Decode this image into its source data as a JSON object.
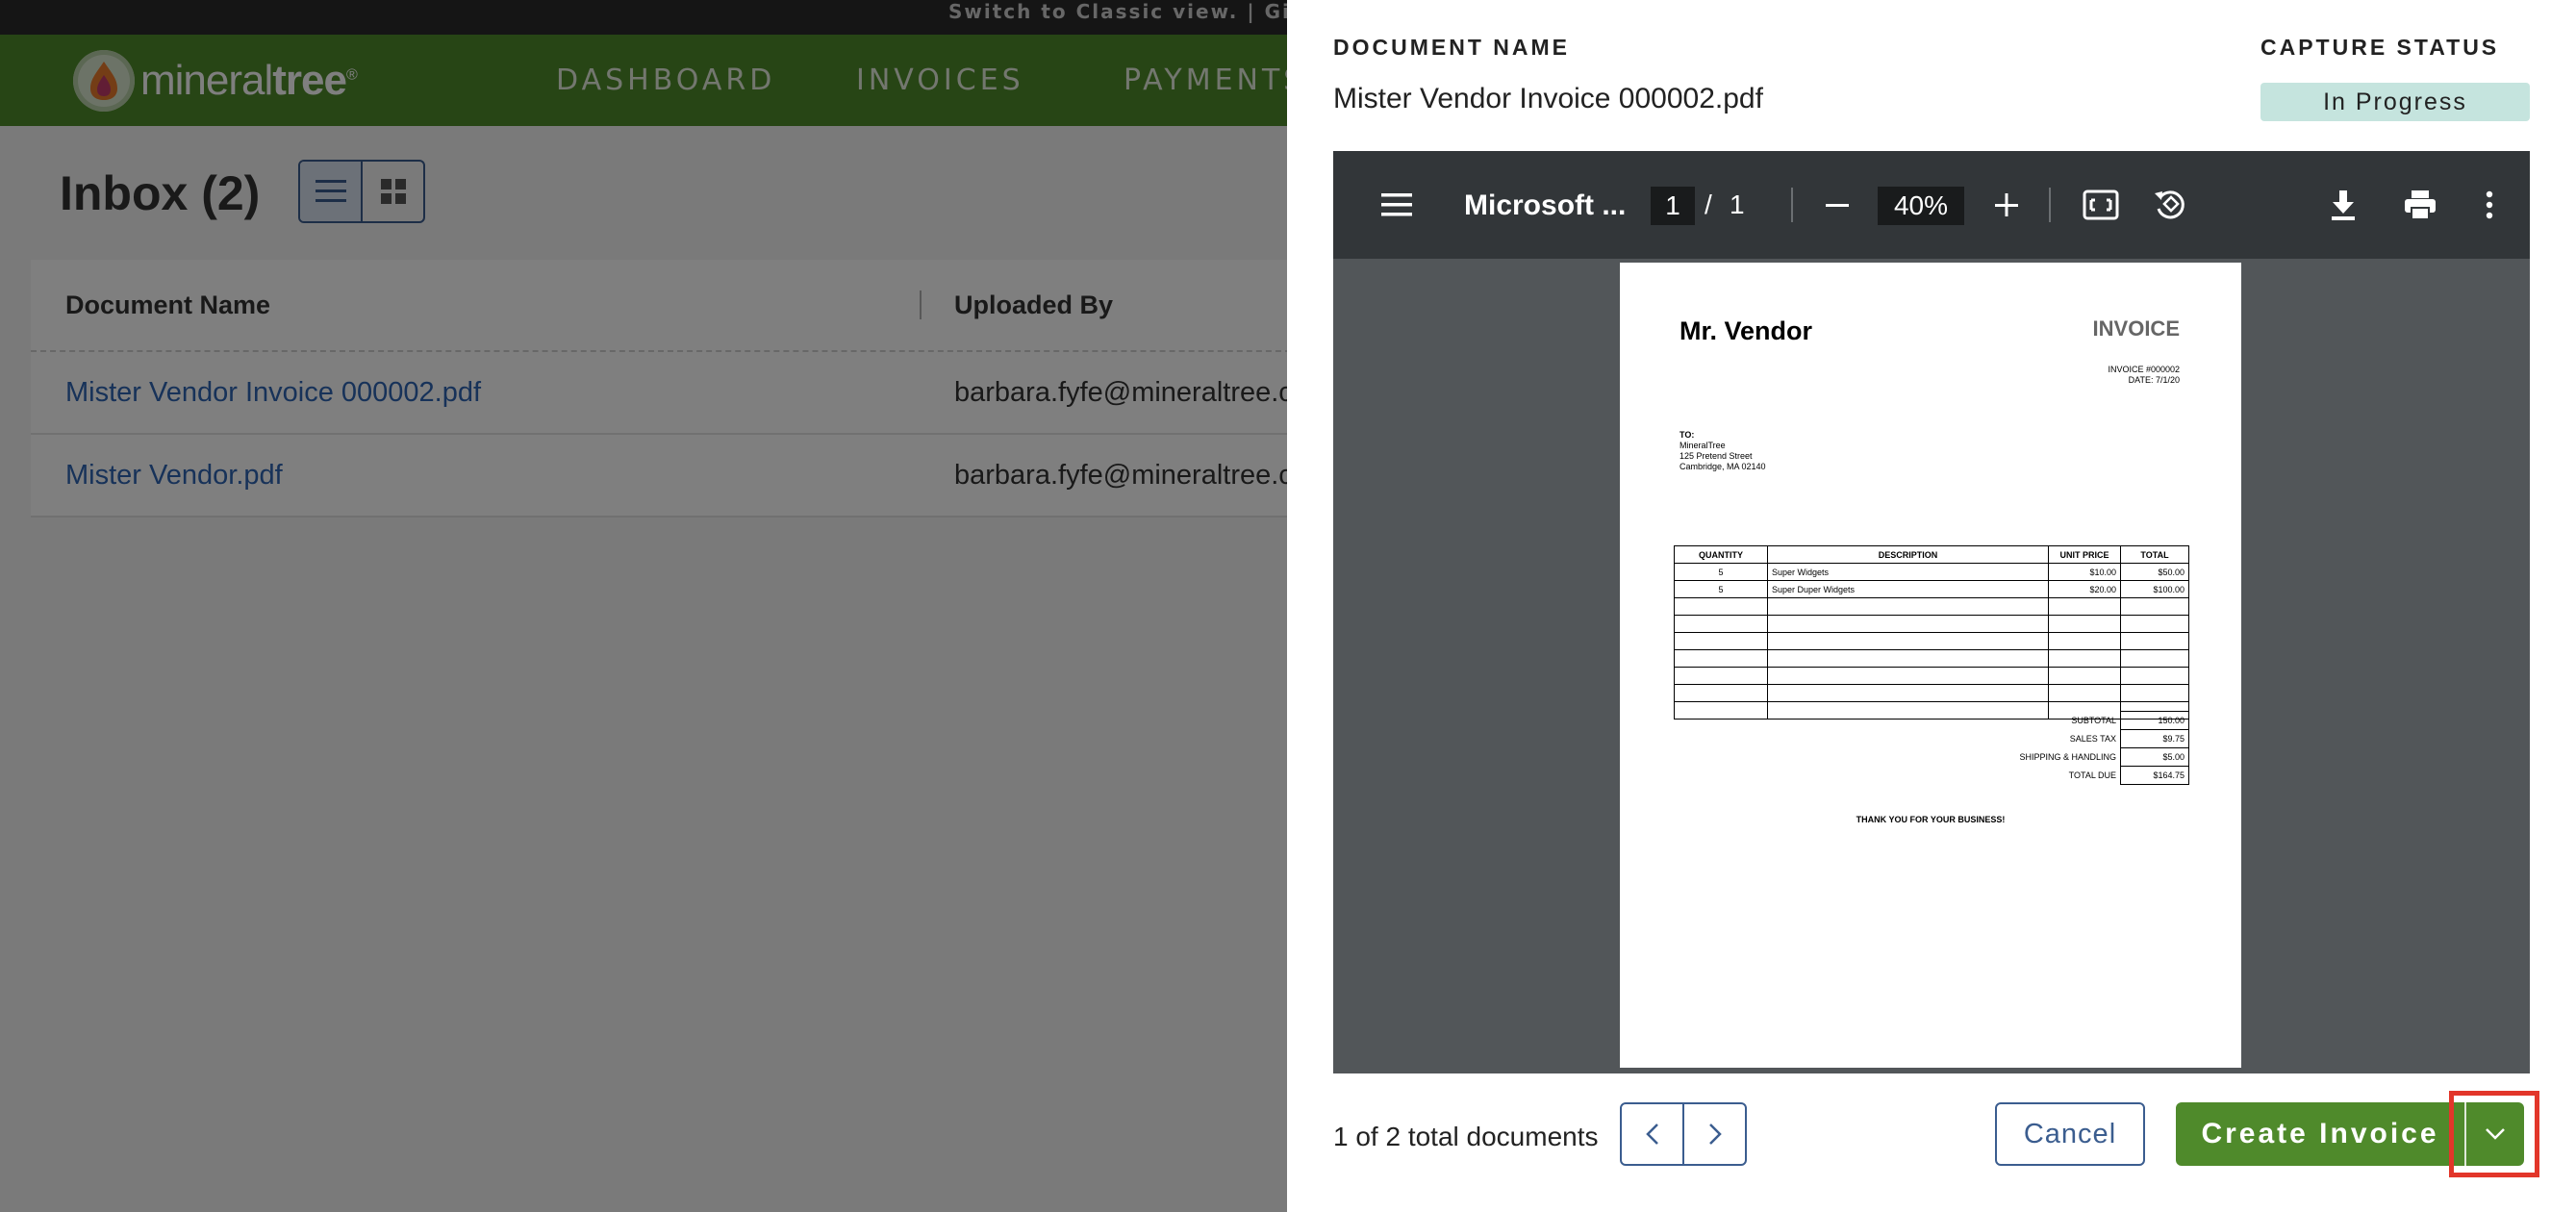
{
  "topbar": {
    "links_text": "Switch to Classic view.  |  Giv"
  },
  "nav": {
    "brand": {
      "part1": "mineral",
      "part2": "tree",
      "reg": "®"
    },
    "items": [
      "DASHBOARD",
      "INVOICES",
      "PAYMENTS"
    ]
  },
  "inbox": {
    "title": "Inbox (2)",
    "columns": [
      "Document Name",
      "Uploaded By"
    ],
    "rows": [
      {
        "document": "Mister Vendor Invoice 000002.pdf",
        "uploaded_by": "barbara.fyfe@mineraltree.co"
      },
      {
        "document": "Mister Vendor.pdf",
        "uploaded_by": "barbara.fyfe@mineraltree.co"
      }
    ]
  },
  "drawer": {
    "document_name_label": "DOCUMENT NAME",
    "document_name": "Mister Vendor Invoice 000002.pdf",
    "capture_status_label": "CAPTURE STATUS",
    "capture_status": "In Progress",
    "viewer": {
      "title": "Microsoft ...",
      "page": "1",
      "separator": "/",
      "total_pages": "1",
      "zoom": "40%"
    },
    "invoice": {
      "vendor": "Mr. Vendor",
      "title": "INVOICE",
      "number": "INVOICE #000002",
      "date": "DATE: 7/1/20",
      "to_label": "TO:",
      "to_lines": [
        "MineralTree",
        "125 Pretend Street",
        "Cambridge, MA 02140"
      ],
      "headers": [
        "QUANTITY",
        "DESCRIPTION",
        "UNIT PRICE",
        "TOTAL"
      ],
      "items": [
        {
          "qty": "5",
          "desc": "Super Widgets",
          "unit": "$10.00",
          "total": "$50.00"
        },
        {
          "qty": "5",
          "desc": "Super Duper Widgets",
          "unit": "$20.00",
          "total": "$100.00"
        }
      ],
      "subtotal_label": "SUBTOTAL",
      "subtotal": "150.00",
      "tax_label": "SALES TAX",
      "tax": "$9.75",
      "shipping_label": "SHIPPING & HANDLING",
      "shipping": "$5.00",
      "total_label": "TOTAL DUE",
      "total_due": "$164.75",
      "thanks": "THANK YOU FOR YOUR BUSINESS!"
    },
    "doc_count": "1 of 2 total documents",
    "cancel_label": "Cancel",
    "create_label": "Create Invoice"
  },
  "colors": {
    "brand_green": "#4f8a2b",
    "link_blue": "#2f65b3",
    "status_bg": "#c5e4de",
    "highlight": "#e2362a"
  }
}
